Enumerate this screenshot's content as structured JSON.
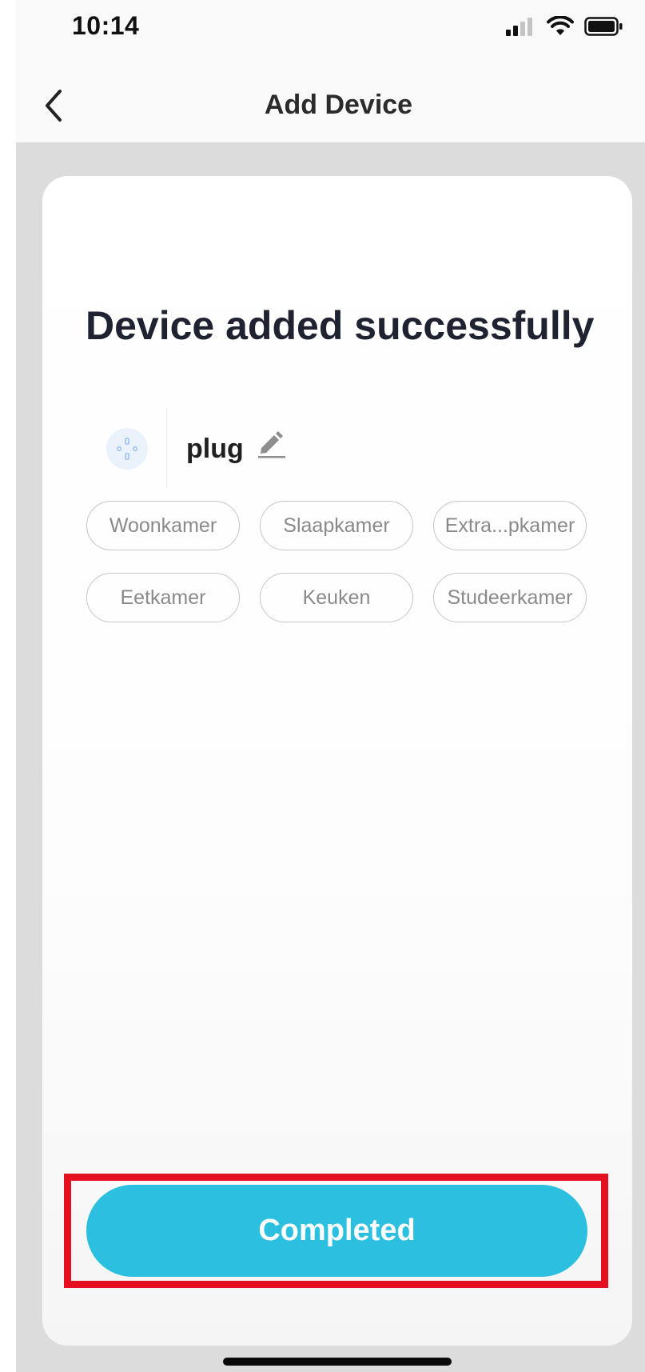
{
  "status_bar": {
    "time": "10:14"
  },
  "nav": {
    "title": "Add Device"
  },
  "card": {
    "heading": "Device added successfully",
    "device": {
      "name": "plug",
      "icon": "smart-plug-icon"
    },
    "rooms": [
      "Woonkamer",
      "Slaapkamer",
      "Extra...pkamer",
      "Eetkamer",
      "Keuken",
      "Studeerkamer"
    ]
  },
  "footer": {
    "completed_label": "Completed"
  },
  "colors": {
    "accent": "#2bbfe0",
    "highlight": "#e4101f",
    "background": "#dcdcdc"
  }
}
